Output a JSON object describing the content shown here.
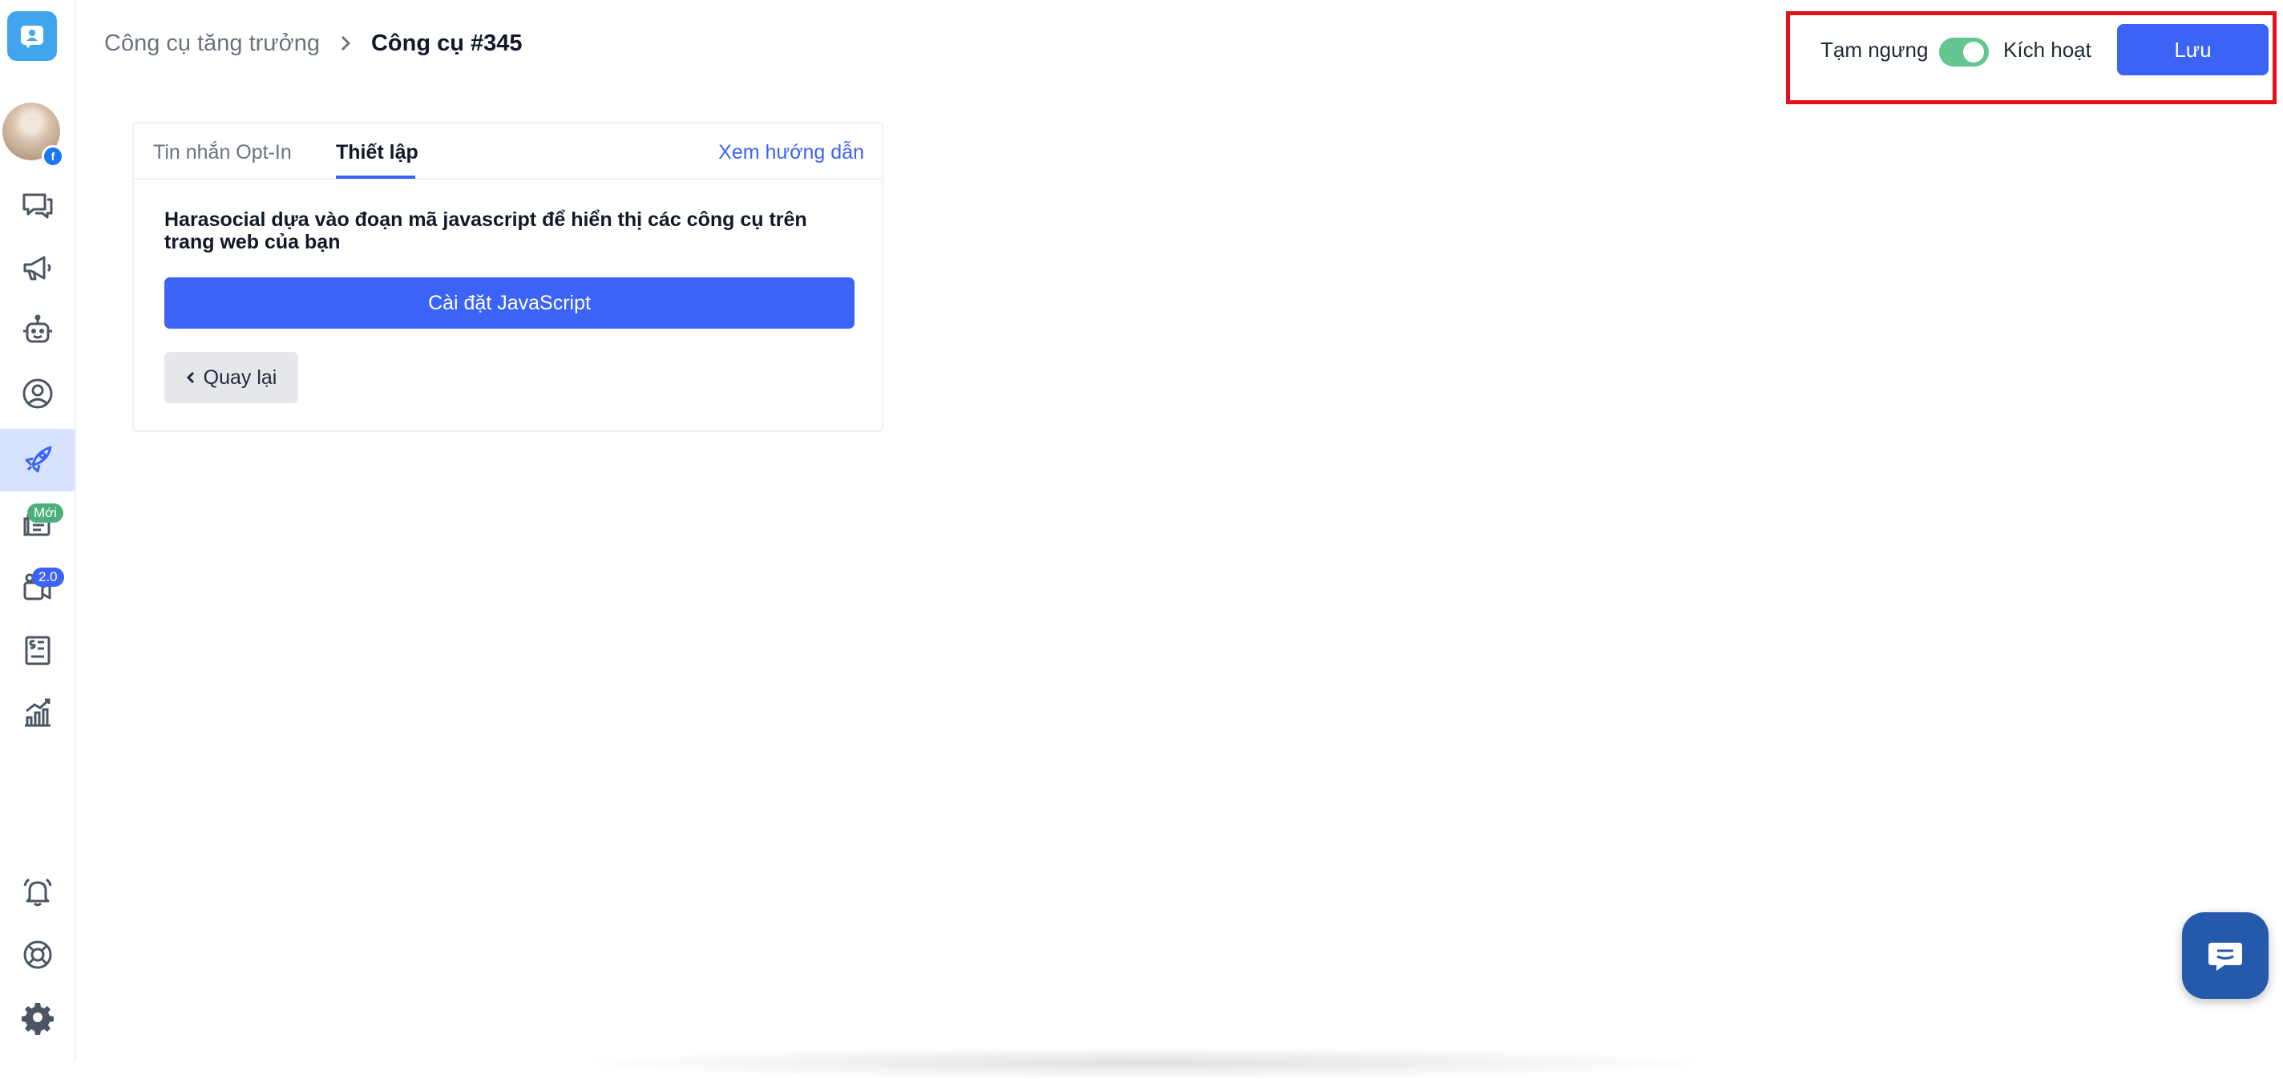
{
  "breadcrumb": {
    "parent": "Công cụ tăng trưởng",
    "current": "Công cụ #345"
  },
  "header": {
    "status_off": "Tạm ngưng",
    "status_on": "Kích hoạt",
    "toggle_on": true,
    "save_label": "Lưu"
  },
  "sidebar": {
    "items": [
      {
        "icon": "chat-icon"
      },
      {
        "icon": "megaphone-icon"
      },
      {
        "icon": "bot-icon"
      },
      {
        "icon": "user-circle-icon"
      },
      {
        "icon": "rocket-icon",
        "active": true
      },
      {
        "icon": "news-icon",
        "badge": "Mới"
      },
      {
        "icon": "video-icon",
        "badge": "2.0"
      },
      {
        "icon": "invoice-icon"
      },
      {
        "icon": "chart-icon"
      },
      {
        "icon": "bell-icon"
      },
      {
        "icon": "lifebuoy-icon"
      },
      {
        "icon": "gear-icon"
      }
    ]
  },
  "card": {
    "tabs": [
      "Tin nhắn Opt-In",
      "Thiết lập"
    ],
    "active_tab": "Thiết lập",
    "guide_link": "Xem hướng dẫn",
    "description": "Harasocial dựa vào đoạn mã javascript để hiển thị các công cụ trên trang web của bạn",
    "install_button": "Cài đặt JavaScript",
    "back_button": "Quay lại"
  },
  "colors": {
    "primary": "#3b63f5",
    "toggle": "#63c58f",
    "highlight_border": "#e3101b",
    "chat_bubble": "#2459ab"
  }
}
